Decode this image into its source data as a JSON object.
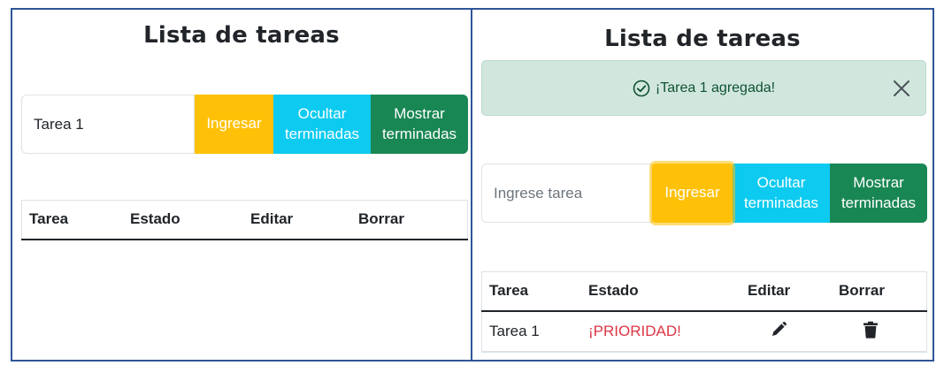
{
  "left": {
    "title": "Lista de tareas",
    "input": {
      "value": "Tarea 1",
      "placeholder": "Ingrese tarea"
    },
    "buttons": {
      "add": "Ingresar",
      "hide_line1": "Ocultar",
      "hide_line2": "terminadas",
      "show_line1": "Mostrar",
      "show_line2": "terminadas"
    },
    "table": {
      "headers": [
        "Tarea",
        "Estado",
        "Editar",
        "Borrar"
      ]
    }
  },
  "right": {
    "title": "Lista de tareas",
    "alert": {
      "text": "¡Tarea 1 agregada!",
      "icon": "check-circle-icon"
    },
    "input": {
      "value": "",
      "placeholder": "Ingrese tarea"
    },
    "buttons": {
      "add": "Ingresar",
      "hide_line1": "Ocultar",
      "hide_line2": "terminadas",
      "show_line1": "Mostrar",
      "show_line2": "terminadas"
    },
    "table": {
      "headers": [
        "Tarea",
        "Estado",
        "Editar",
        "Borrar"
      ],
      "rows": [
        {
          "task": "Tarea 1",
          "status": "¡PRIORIDAD!",
          "edit_icon": "pencil-icon",
          "delete_icon": "trash-icon"
        }
      ]
    }
  },
  "colors": {
    "warning": "#ffc107",
    "info": "#0dcaf0",
    "success": "#198754",
    "danger": "#dc3545",
    "alert_bg": "#d1e7dd",
    "panel_border": "#2f5597"
  }
}
